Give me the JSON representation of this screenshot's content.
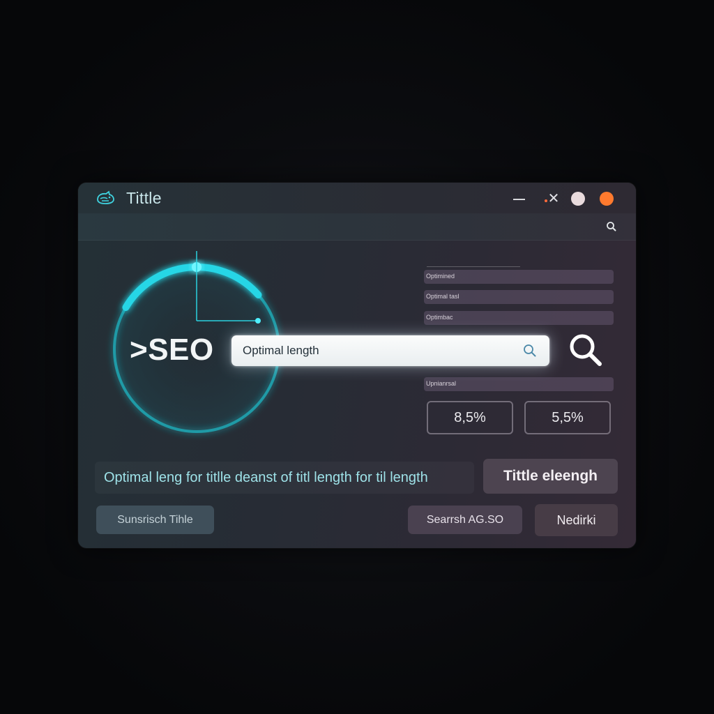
{
  "window": {
    "title": "Tittle",
    "logo_icon": "cat-logo-icon",
    "controls": [
      "minimize-icon",
      "close-icon",
      "maximize-light-icon",
      "status-orange-icon"
    ]
  },
  "toolbar": {
    "search_icon": "search-icon"
  },
  "gauge": {
    "label": ">SEO",
    "progress": 0.3,
    "accent_color": "#27d6e6"
  },
  "search": {
    "value": "Optimal length",
    "icon": "search-icon"
  },
  "metrics_list": {
    "items": [
      {
        "label": "Optimined"
      },
      {
        "label": "Optimal tasl"
      },
      {
        "label": "Optimbac"
      },
      {
        "label": "Upnianrsal"
      }
    ]
  },
  "stats": {
    "values": [
      "8,5%",
      "5,5%"
    ]
  },
  "description": {
    "text": "Optimal leng for  titlle deanst of titl length for til length"
  },
  "buttons": {
    "title_length": "Tittle eleengh",
    "submit": "Sunsrisch Tihle",
    "search_seo": "Searrsh AG.SO",
    "nedirki": "Nedirki"
  },
  "colors": {
    "accent": "#27d6e6",
    "window_close_dot": "#ff6a3a",
    "orange_control": "#ff7a2e"
  }
}
